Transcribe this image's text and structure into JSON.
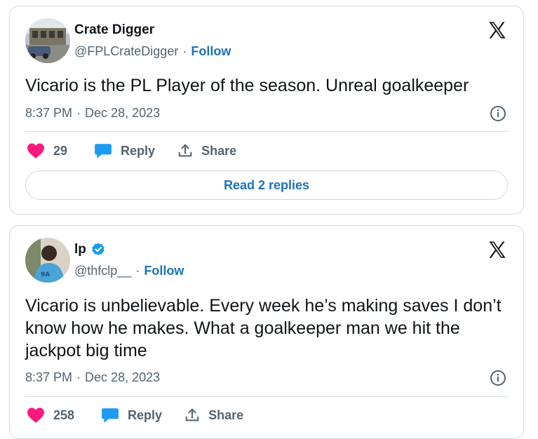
{
  "tweets": [
    {
      "author": "Crate Digger",
      "handle": "@FPLCrateDigger",
      "follow_label": "Follow",
      "verified": false,
      "text": "Vicario is the PL Player of the season. Unreal goalkeeper",
      "time": "8:37 PM",
      "date": "Dec 28, 2023",
      "likes": "29",
      "reply_label": "Reply",
      "share_label": "Share",
      "read_replies_label": "Read 2 replies"
    },
    {
      "author": "lp",
      "handle": "@thfclp__",
      "follow_label": "Follow",
      "verified": true,
      "text": "Vicario is unbelievable. Every week he’s making saves I don’t know how he makes. What a goalkeeper man we hit the jackpot big time",
      "time": "8:37 PM",
      "date": "Dec 28, 2023",
      "likes": "258",
      "reply_label": "Reply",
      "share_label": "Share"
    }
  ],
  "separator": "·",
  "colors": {
    "accent": "#1d73b7",
    "like": "#f91880",
    "reply_bubble": "#1d9bf0",
    "muted": "#536471",
    "border": "#cfd9de"
  },
  "icons": {
    "x_logo": "x-logo-icon",
    "info": "info-icon",
    "like": "heart-icon",
    "reply": "reply-bubble-icon",
    "share": "share-icon",
    "verified": "verified-badge-icon"
  }
}
